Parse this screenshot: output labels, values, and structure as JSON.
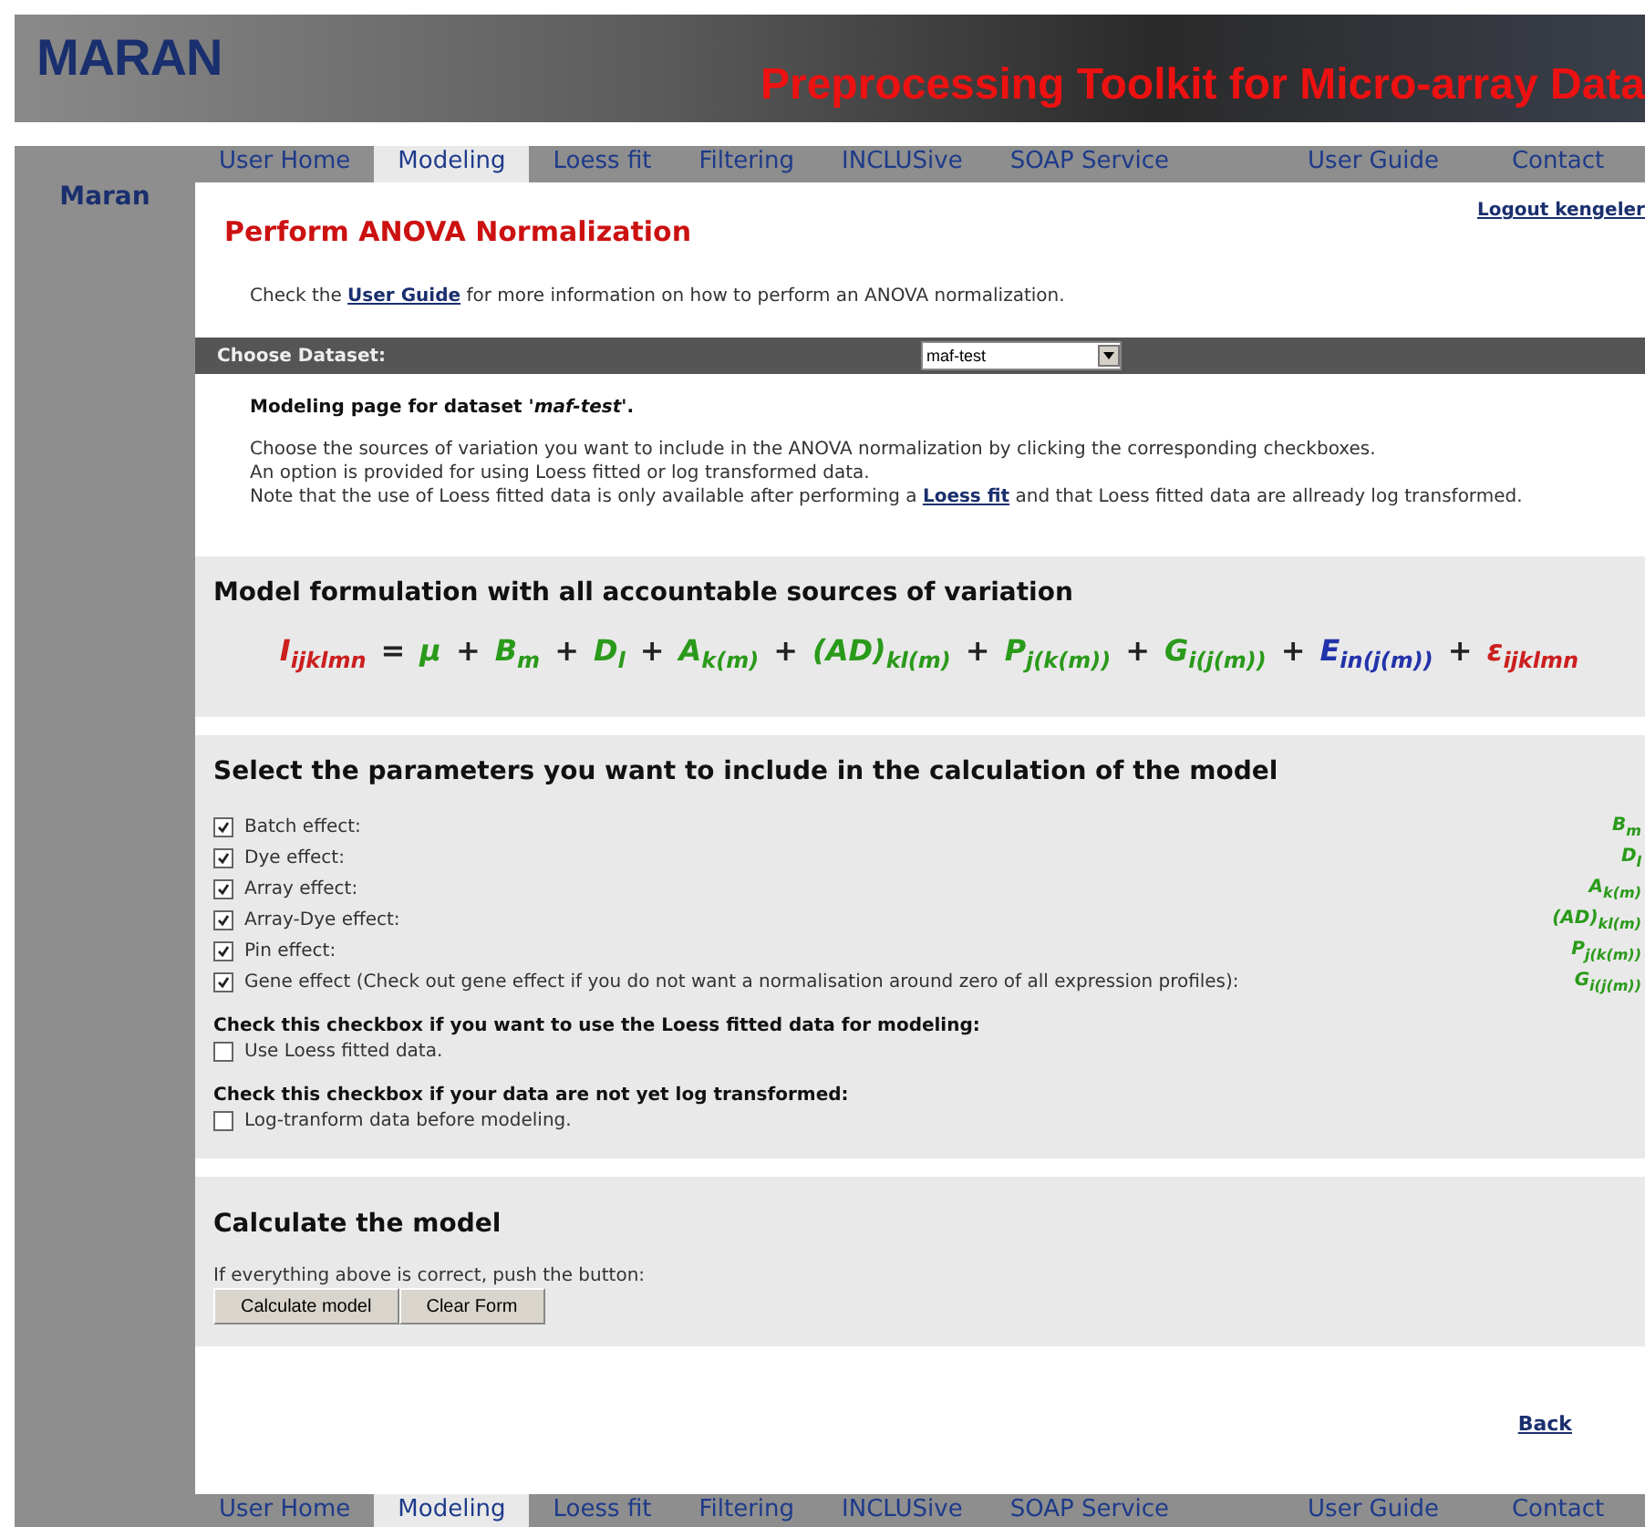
{
  "header": {
    "logo": "MARAN",
    "tagline": "Preprocessing Toolkit for Micro-array Data"
  },
  "sidebar": {
    "title": "Maran"
  },
  "nav_top": [
    {
      "label": "User Home",
      "selected": false
    },
    {
      "label": "Modeling",
      "selected": true
    },
    {
      "label": "Loess fit",
      "selected": false
    },
    {
      "label": "Filtering",
      "selected": false
    },
    {
      "label": "INCLUSive",
      "selected": false
    },
    {
      "label": "SOAP Service",
      "selected": false
    },
    {
      "label": "User Guide",
      "selected": false
    },
    {
      "label": "Contact",
      "selected": false
    }
  ],
  "page": {
    "title": "Perform ANOVA Normalization",
    "logout": "Logout kengeler",
    "intro_before": "Check the",
    "intro_link": "User Guide",
    "intro_after": "for more information on how to perform an ANOVA normalization."
  },
  "dataset": {
    "label": "Choose Dataset:",
    "value": "maf-test"
  },
  "description": {
    "heading": "Modeling page for dataset *'maf-test'*.",
    "lines": [
      "Choose the sources of variation you want to include in the ANOVA normalization by clicking the corresponding checkboxes.",
      "An option is provided for using Loess fitted or log transformed data."
    ],
    "note_before": "Note that the use of Loess fitted data is only available after performing a",
    "note_link": "Loess fit",
    "note_after": "and that Loess fitted data are allready log transformed."
  },
  "formulation": {
    "heading": "Model formulation with all accountable sources of variation",
    "terms": [
      {
        "text": "I$_{ijklmn}$",
        "color": "#cc1f1f"
      },
      {
        "text": "=",
        "color": "#222222"
      },
      {
        "text": "μ",
        "color": "#2a9a1a"
      },
      {
        "text": "+",
        "color": "#222222"
      },
      {
        "text": "B$_{m}$",
        "color": "#2a9a1a"
      },
      {
        "text": "+",
        "color": "#222222"
      },
      {
        "text": "D$_{l}$",
        "color": "#2a9a1a"
      },
      {
        "text": "+",
        "color": "#222222"
      },
      {
        "text": "A$_{k(m)}$",
        "color": "#2a9a1a"
      },
      {
        "text": "+",
        "color": "#222222"
      },
      {
        "text": "(AD)$_{kl(m)}$",
        "color": "#2a9a1a"
      },
      {
        "text": "+",
        "color": "#222222"
      },
      {
        "text": "P$_{j(k(m))}$",
        "color": "#2a9a1a"
      },
      {
        "text": "+",
        "color": "#222222"
      },
      {
        "text": "G$_{i(j(m))}$",
        "color": "#2a9a1a"
      },
      {
        "text": "+",
        "color": "#222222"
      },
      {
        "text": "E$_{in(j(m))}$",
        "color": "#2233aa"
      },
      {
        "text": "+",
        "color": "#222222"
      },
      {
        "text": "ε$_{ijklmn}$",
        "color": "#cc1f1f"
      }
    ]
  },
  "parameters": {
    "heading": "Select the parameters you want to include in the calculation of the model",
    "items": [
      {
        "label": "Batch effect:",
        "checked": true,
        "symbol": "B$_{m}$"
      },
      {
        "label": "Dye effect:",
        "checked": true,
        "symbol": "D$_{l}$"
      },
      {
        "label": "Array effect:",
        "checked": true,
        "symbol": "A$_{k(m)}$"
      },
      {
        "label": "Array-Dye effect:",
        "checked": true,
        "symbol": "(AD)$_{kl(m)}$"
      },
      {
        "label": "Pin effect:",
        "checked": true,
        "symbol": "P$_{j(k(m))}$"
      },
      {
        "label": "Gene effect (Check out gene effect if you do not want a normalisation around zero of all expression profiles):",
        "checked": true,
        "symbol": "G$_{i(j(m))}$"
      }
    ],
    "options": [
      {
        "question": "Check this checkbox if you want to use the Loess fitted data for modeling:",
        "label": "Use Loess fitted data.",
        "checked": false
      },
      {
        "question": "Check this checkbox if your data are not yet log transformed:",
        "label": "Log-tranform data before modeling.",
        "checked": false
      }
    ]
  },
  "calculate": {
    "heading": "Calculate the model",
    "hint": "If everything above is correct, push the button:",
    "buttons": [
      "Calculate model",
      "Clear Form"
    ]
  },
  "back": "Back",
  "nav_bottom": [
    {
      "label": "User Home",
      "selected": false
    },
    {
      "label": "Modeling",
      "selected": true
    },
    {
      "label": "Loess fit",
      "selected": false
    },
    {
      "label": "Filtering",
      "selected": false
    },
    {
      "label": "INCLUSive",
      "selected": false
    },
    {
      "label": "SOAP Service",
      "selected": false
    },
    {
      "label": "User Guide",
      "selected": false
    },
    {
      "label": "Contact",
      "selected": false
    }
  ]
}
